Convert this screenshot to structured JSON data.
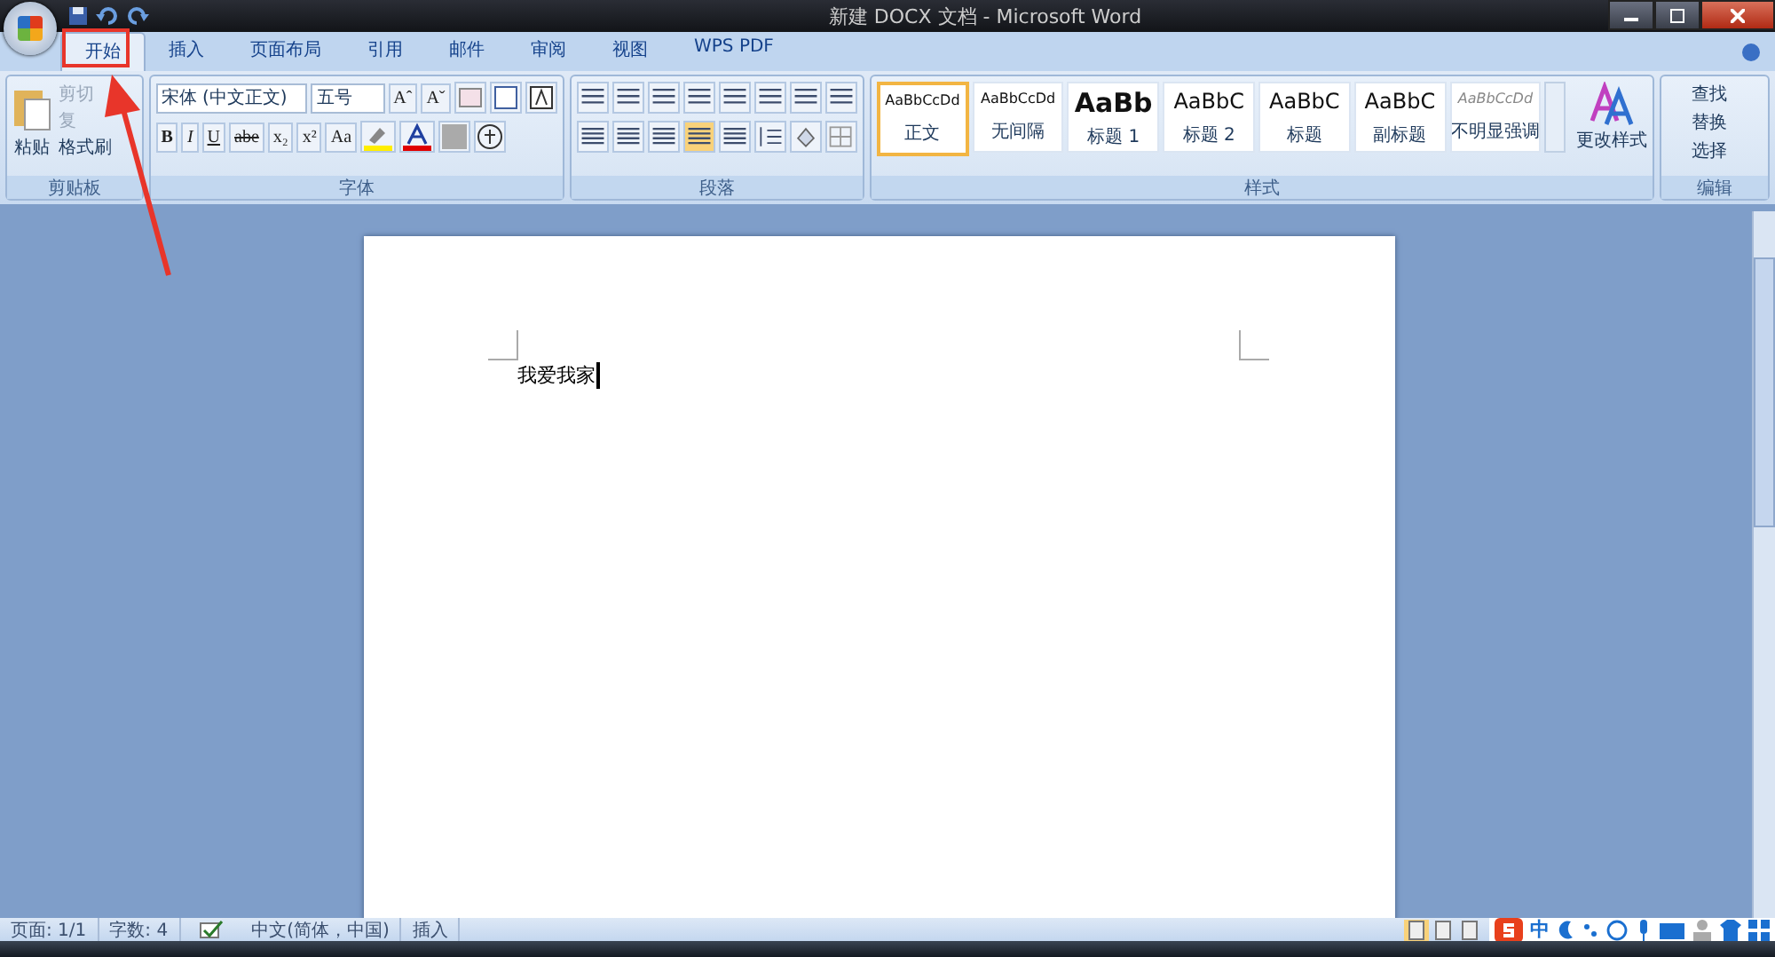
{
  "window": {
    "title": "新建 DOCX 文档 - Microsoft Word"
  },
  "tabs": [
    {
      "label": "开始",
      "selected": true
    },
    {
      "label": "插入",
      "selected": false
    },
    {
      "label": "页面布局",
      "selected": false
    },
    {
      "label": "引用",
      "selected": false
    },
    {
      "label": "邮件",
      "selected": false
    },
    {
      "label": "审阅",
      "selected": false
    },
    {
      "label": "视图",
      "selected": false
    },
    {
      "label": "WPS PDF",
      "selected": false
    }
  ],
  "clipboard": {
    "label": "剪贴板",
    "paste": "粘贴",
    "items": [
      {
        "label": "剪切",
        "disabled": true
      },
      {
        "label": "复",
        "disabled": true
      },
      {
        "label": "格式刷",
        "disabled": false
      }
    ]
  },
  "font": {
    "label": "字体",
    "name": "宋体 (中文正文)",
    "size": "五号",
    "row1": [
      "Aˆ",
      "Aˇ"
    ],
    "row2": [
      {
        "label": "B",
        "kind": "bold"
      },
      {
        "label": "I",
        "kind": "italic"
      },
      {
        "label": "U",
        "kind": "underline"
      },
      {
        "label": "abe",
        "kind": "strike"
      },
      {
        "label": "x₂",
        "kind": "plain"
      },
      {
        "label": "x²",
        "kind": "plain"
      },
      {
        "label": "Aa",
        "kind": "plain"
      }
    ]
  },
  "paragraph": {
    "label": "段落"
  },
  "styles": {
    "label": "样式",
    "change": "更改样式",
    "items": [
      {
        "preview": "AaBbCcDd",
        "label": "正文",
        "kind": "normal",
        "selected": true
      },
      {
        "preview": "AaBbCcDd",
        "label": "无间隔",
        "kind": "normal",
        "selected": false
      },
      {
        "preview": "AaBb",
        "label": "标题 1",
        "kind": "heading1",
        "selected": false
      },
      {
        "preview": "AaBbC",
        "label": "标题 2",
        "kind": "heading",
        "selected": false
      },
      {
        "preview": "AaBbC",
        "label": "标题",
        "kind": "heading",
        "selected": false
      },
      {
        "preview": "AaBbC",
        "label": "副标题",
        "kind": "heading",
        "selected": false
      },
      {
        "preview": "AaBbCcDd",
        "label": "不明显强调",
        "kind": "subtle",
        "selected": false
      }
    ]
  },
  "editing": {
    "label": "编辑",
    "items": [
      "查找",
      "替换",
      "选择"
    ]
  },
  "document": {
    "text": "我爱我家"
  },
  "status_bar": {
    "page": "页面: 1/1",
    "words": "字数: 4",
    "language": "中文(简体，中国)",
    "mode": "插入"
  },
  "ime": {
    "label": "中"
  }
}
